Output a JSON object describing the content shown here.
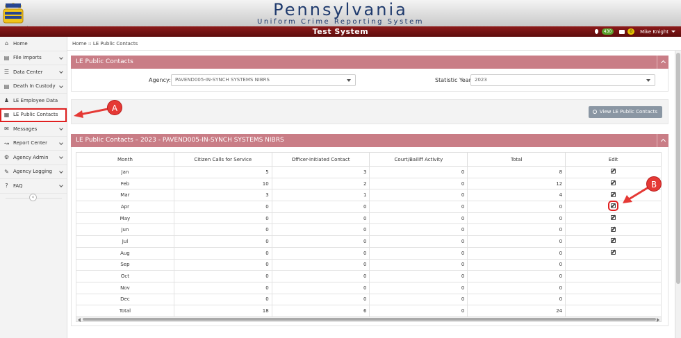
{
  "header": {
    "title": "Pennsylvania",
    "subtitle": "Uniform Crime Reporting System",
    "environment": "Test System",
    "alerts_count": "430",
    "messages_count": "0",
    "user_name": "Mike Knight"
  },
  "sidebar": {
    "items": [
      {
        "label": "Home",
        "icon": "home-icon"
      },
      {
        "label": "File Imports",
        "icon": "folder-icon"
      },
      {
        "label": "Data Center",
        "icon": "database-icon"
      },
      {
        "label": "Death In Custody",
        "icon": "folder-icon"
      },
      {
        "label": "LE Employee Data",
        "icon": "users-icon"
      },
      {
        "label": "LE Public Contacts",
        "icon": "calendar-icon"
      },
      {
        "label": "Messages",
        "icon": "envelope-icon"
      },
      {
        "label": "Report Center",
        "icon": "chart-icon"
      },
      {
        "label": "Agency Admin",
        "icon": "gears-icon"
      },
      {
        "label": "Agency Logging",
        "icon": "logging-icon"
      },
      {
        "label": "FAQ",
        "icon": "question-icon"
      }
    ],
    "collapse_glyph": "«"
  },
  "breadcrumb": "Home :: LE Public Contacts",
  "filter_panel": {
    "title": "LE Public Contacts",
    "agency_label": "Agency:",
    "agency_value": "PAVEND005-IN-SYNCH SYSTEMS NIBRS",
    "year_label": "Statistic Year:",
    "year_value": "2023",
    "view_button": "View LE Public Contacts"
  },
  "results_panel": {
    "title": "LE Public Contacts – 2023 - PAVEND005-IN-SYNCH SYSTEMS NIBRS",
    "columns": [
      "Month",
      "Citizen Calls for Service",
      "Officer-Initiated Contact",
      "Court/Bailiff Activity",
      "Total",
      "Edit"
    ],
    "rows": [
      {
        "month": "Jan",
        "citizen": "5",
        "officer": "3",
        "court": "0",
        "total": "8",
        "editable": true
      },
      {
        "month": "Feb",
        "citizen": "10",
        "officer": "2",
        "court": "0",
        "total": "12",
        "editable": true
      },
      {
        "month": "Mar",
        "citizen": "3",
        "officer": "1",
        "court": "0",
        "total": "4",
        "editable": true
      },
      {
        "month": "Apr",
        "citizen": "0",
        "officer": "0",
        "court": "0",
        "total": "0",
        "editable": true
      },
      {
        "month": "May",
        "citizen": "0",
        "officer": "0",
        "court": "0",
        "total": "0",
        "editable": true
      },
      {
        "month": "Jun",
        "citizen": "0",
        "officer": "0",
        "court": "0",
        "total": "0",
        "editable": true
      },
      {
        "month": "Jul",
        "citizen": "0",
        "officer": "0",
        "court": "0",
        "total": "0",
        "editable": true
      },
      {
        "month": "Aug",
        "citizen": "0",
        "officer": "0",
        "court": "0",
        "total": "0",
        "editable": true
      },
      {
        "month": "Sep",
        "citizen": "0",
        "officer": "0",
        "court": "0",
        "total": "0",
        "editable": false
      },
      {
        "month": "Oct",
        "citizen": "0",
        "officer": "0",
        "court": "0",
        "total": "0",
        "editable": false
      },
      {
        "month": "Nov",
        "citizen": "0",
        "officer": "0",
        "court": "0",
        "total": "0",
        "editable": false
      },
      {
        "month": "Dec",
        "citizen": "0",
        "officer": "0",
        "court": "0",
        "total": "0",
        "editable": false
      }
    ],
    "total_row": {
      "month": "Total",
      "citizen": "18",
      "officer": "6",
      "court": "0",
      "total": "24"
    }
  },
  "annotations": {
    "a": "A",
    "b": "B",
    "color": "#e53935"
  }
}
